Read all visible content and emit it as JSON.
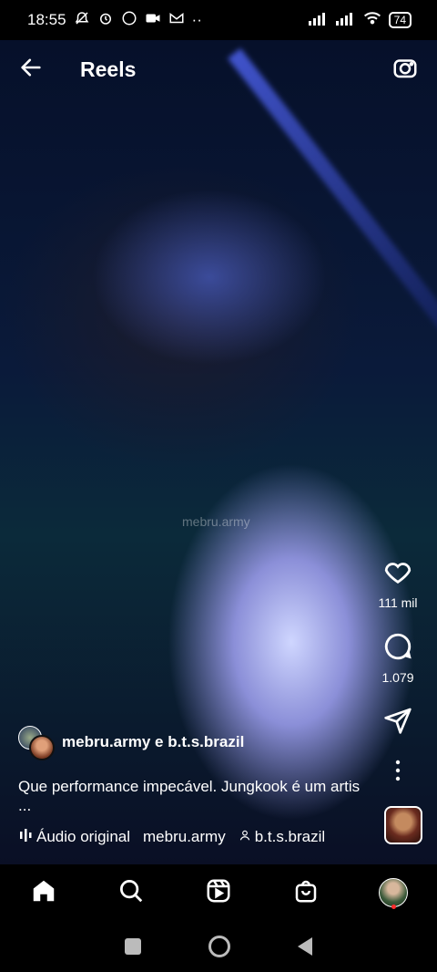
{
  "status": {
    "time": "18:55",
    "dots": "··",
    "battery": "74"
  },
  "header": {
    "title": "Reels"
  },
  "video": {
    "watermark": "mebru.army"
  },
  "actions": {
    "likes": "111 mil",
    "comments": "1.079"
  },
  "post": {
    "author": "mebru.army e b.t.s.brazil",
    "caption": "Que performance impecável. Jungkook é um artis",
    "caption_more": "...",
    "audio": "Áudio original",
    "audio_author": "mebru.army",
    "collab": "b.t.s.brazil"
  },
  "colors": {
    "notification_dot": "#ff2d2d"
  }
}
